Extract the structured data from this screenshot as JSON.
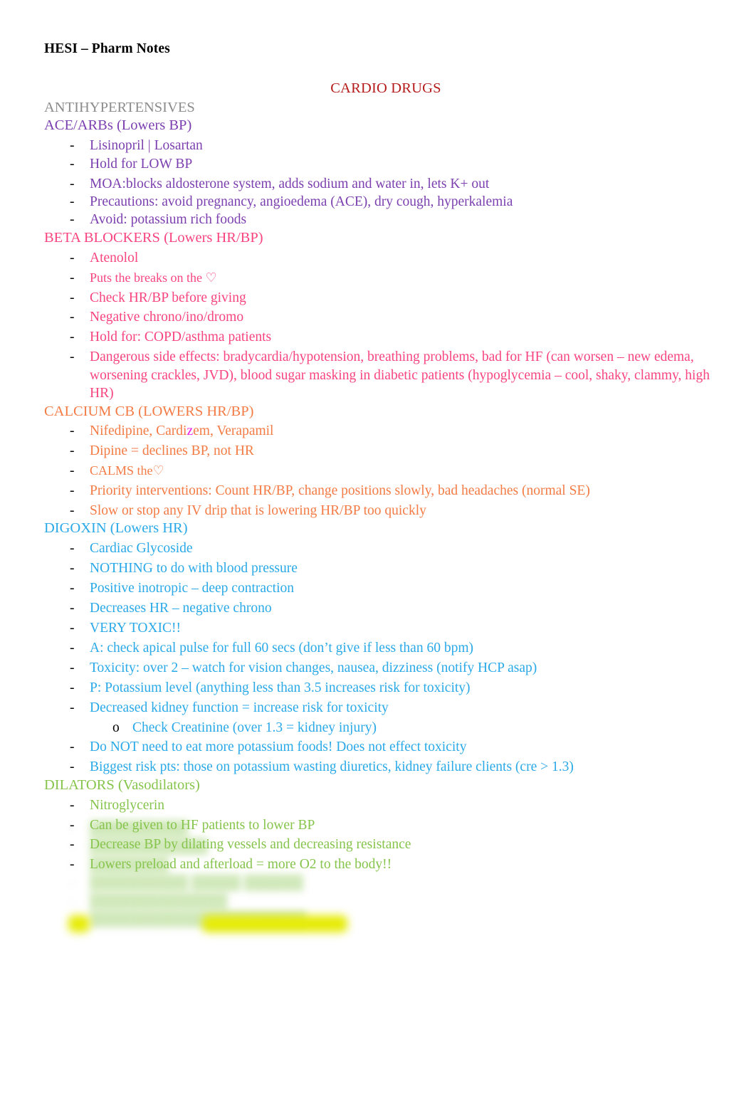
{
  "document": {
    "header": "HESI – Pharm Notes",
    "title": "CARDIO DRUGS"
  },
  "sections": [
    {
      "id": "antihypertensives",
      "heading": "ANTIHYPERTENSIVES",
      "color": "#8c8c8c",
      "items": []
    },
    {
      "id": "ace-arbs",
      "heading": "ACE/ARBs (Lowers BP)",
      "color": "#7b3faf",
      "items": [
        {
          "marker": "-",
          "text": "Lisinopril | Losartan"
        },
        {
          "marker": "-",
          "text": "Hold for LOW BP"
        },
        {
          "marker": "-",
          "text": "MOA:blocks aldosterone system, adds sodium and water in, lets K+ out"
        },
        {
          "marker": "-",
          "text": "Precautions:  avoid pregnancy, angioedema (ACE), dry cough, hyperkalemia"
        },
        {
          "marker": "-",
          "text": "Avoid: potassium rich foods"
        }
      ]
    },
    {
      "id": "beta-blockers",
      "heading": "BETA BLOCKERS (Lowers HR/BP)",
      "color": "#f8447f",
      "items": [
        {
          "marker": "-",
          "text": "Atenolol"
        },
        {
          "marker": "-",
          "text": "Puts the breaks on the  ♡"
        },
        {
          "marker": "-",
          "text": "Check HR/BP before giving"
        },
        {
          "marker": "-",
          "text": "Negative chrono/ino/dromo"
        },
        {
          "marker": "-",
          "text": "Hold for: COPD/asthma patients"
        },
        {
          "marker": "-",
          "text": "Dangerous side effects:  bradycardia/hypotension, breathing problems, bad for HF (can worsen – new edema, worsening crackles, JVD), blood sugar masking in diabetic patients (hypoglycemia – cool, shaky, clammy, high HR)"
        }
      ]
    },
    {
      "id": "calcium-cb",
      "heading": "CALCIUM CB (LOWERS HR/BP)",
      "color": "#f47b45",
      "items": [
        {
          "marker": "-",
          "text": "Nifedipine,  Cardizem,  Verapamil",
          "rich": true
        },
        {
          "marker": "-",
          "text": "Dipine = declines BP, not HR"
        },
        {
          "marker": "-",
          "text": "CALMS the♡"
        },
        {
          "marker": "-",
          "text": "Priority interventions:  Count HR/BP, change positions slowly, bad headaches (normal SE)"
        },
        {
          "marker": "-",
          "text": "Slow or stop any IV drip that is lowering HR/BP too quickly"
        }
      ],
      "rich_parts": {
        "cardizem_pre": "Nifedipine,  Cardi",
        "cardizem_z": "z",
        "cardizem_post": "em,  Verapamil"
      }
    },
    {
      "id": "digoxin",
      "heading": "DIGOXIN (Lowers HR)",
      "color": "#2aa9e8",
      "items": [
        {
          "marker": "-",
          "text": "Cardiac Glycoside"
        },
        {
          "marker": "-",
          "text": "NOTHING to do with blood pressure"
        },
        {
          "marker": "-",
          "text": "Positive inotropic – deep contraction"
        },
        {
          "marker": "-",
          "text": "Decreases HR – negative chrono"
        },
        {
          "marker": "-",
          "text": "VERY TOXIC!!"
        },
        {
          "marker": "-",
          "text": "A: check apical pulse for full 60 secs (don’t give if less than 60 bpm)"
        },
        {
          "marker": "-",
          "text": "Toxicity: over 2 – watch for vision changes, nausea, dizziness (notify HCP asap)"
        },
        {
          "marker": "-",
          "text": "P: Potassium level (anything less than 3.5 increases risk for toxicity)"
        },
        {
          "marker": "-",
          "text": "Decreased kidney function = increase risk for toxicity"
        },
        {
          "marker": "o",
          "sub": true,
          "text": "Check Creatinine (over 1.3 = kidney injury)"
        },
        {
          "marker": "-",
          "text": "Do NOT need to eat more potassium foods! Does not effect toxicity"
        },
        {
          "marker": "-",
          "text": "Biggest risk pts: those on potassium wasting diuretics, kidney failure clients (cre > 1.3)"
        }
      ]
    },
    {
      "id": "dilators",
      "heading": "DILATORS (Vasodilators)",
      "color": "#86c44c",
      "items": [
        {
          "marker": "-",
          "text": "Nitroglycerin"
        },
        {
          "marker": "-",
          "text": "Can be given to HF patients to lower BP"
        },
        {
          "marker": "-",
          "text": "Decrease BP by dilating vessels and decreasing resistance"
        },
        {
          "marker": "-",
          "text": "Lowers preload and afterload = more O2 to the body!!"
        }
      ]
    }
  ],
  "obscured_region": {
    "note": "blurred / redacted lines at bottom of page",
    "color": "#86c44c",
    "highlight_color": "#ecec06",
    "lines": [
      {
        "marker": "-",
        "text": "██████████"
      },
      {
        "marker": "-",
        "text": "████████████"
      },
      {
        "marker": "-",
        "text": "████████"
      },
      {
        "marker": "-",
        "text": "██████████   █████ ██████"
      },
      {
        "marker": "-",
        "text": "██████████████"
      },
      {
        "marker": "-",
        "text": "██████████████████████"
      }
    ]
  }
}
